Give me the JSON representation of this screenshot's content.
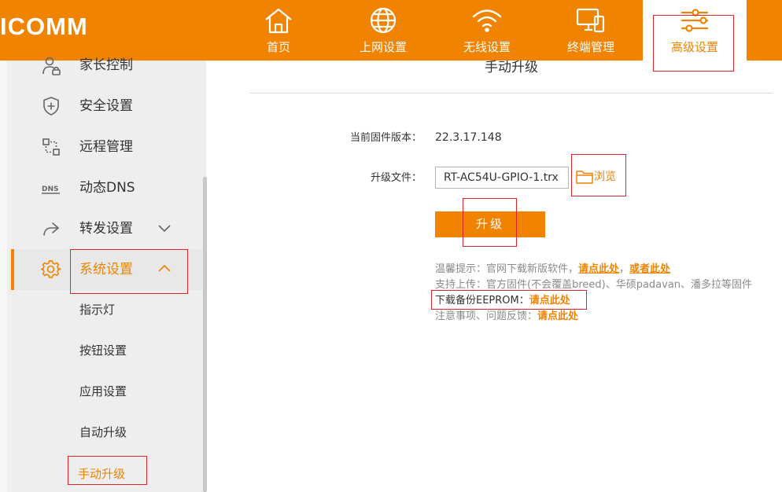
{
  "brand": "ICOMM",
  "nav": [
    {
      "label": "首页",
      "icon": "home-icon"
    },
    {
      "label": "上网设置",
      "icon": "globe-icon"
    },
    {
      "label": "无线设置",
      "icon": "wifi-icon"
    },
    {
      "label": "终端管理",
      "icon": "devices-icon"
    },
    {
      "label": "高级设置",
      "icon": "sliders-icon",
      "active": true
    }
  ],
  "sidebar": {
    "items": [
      {
        "label": "家长控制",
        "icon": "parental-control-icon"
      },
      {
        "label": "安全设置",
        "icon": "shield-icon"
      },
      {
        "label": "远程管理",
        "icon": "remote-management-icon"
      },
      {
        "label": "动态DNS",
        "icon": "dns-icon"
      },
      {
        "label": "转发设置",
        "icon": "share-arrow-icon",
        "expandable": true
      },
      {
        "label": "系统设置",
        "icon": "gear-icon",
        "expanded": true,
        "active": true
      }
    ],
    "sub_items": [
      {
        "label": "指示灯"
      },
      {
        "label": "按钮设置"
      },
      {
        "label": "应用设置"
      },
      {
        "label": "自动升级"
      },
      {
        "label": "手动升级",
        "current": true
      }
    ]
  },
  "main": {
    "title": "手动升级",
    "firmware_label": "当前固件版本：",
    "firmware_version": "22.3.17.148",
    "file_label": "升级文件：",
    "file_value": "RT-AC54U-GPIO-1.trx",
    "browse_label": "浏览",
    "upgrade_button": "升级",
    "tips": {
      "line1_prefix": "温馨提示：官网下载新版软件，",
      "line1_link1": "请点此处",
      "line1_sep": "，",
      "line1_link2": "或者此处",
      "line2": "支持上传：官方固件(不会覆盖breed)、华硕padavan、潘多拉等固件",
      "line3_prefix": "下载备份EEPROM：",
      "line3_link": "请点此处",
      "line4_prefix": "注意事项、问题反馈：",
      "line4_link": "请点此处"
    }
  },
  "colors": {
    "accent": "#f08300",
    "sidebar_bg": "#eeeeee",
    "annotation": "#e0242b"
  }
}
